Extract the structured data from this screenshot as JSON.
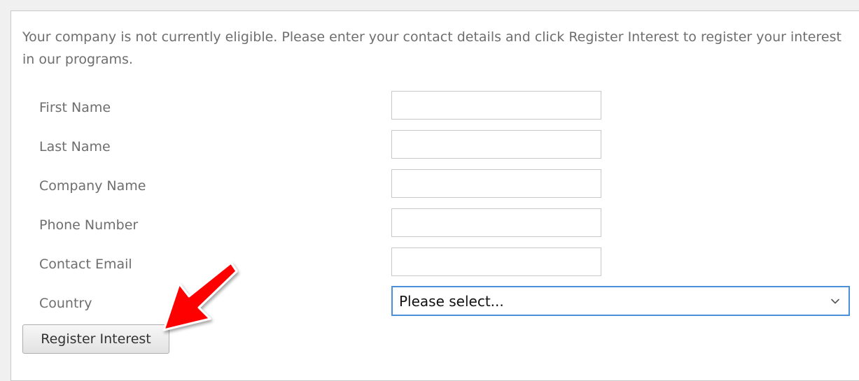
{
  "form": {
    "intro_text": "Your company is not currently eligible. Please enter your contact details and click Register Interest to register your interest in our programs.",
    "fields": {
      "first_name": {
        "label": "First Name",
        "value": ""
      },
      "last_name": {
        "label": "Last Name",
        "value": ""
      },
      "company_name": {
        "label": "Company Name",
        "value": ""
      },
      "phone_number": {
        "label": "Phone Number",
        "value": ""
      },
      "contact_email": {
        "label": "Contact Email",
        "value": ""
      },
      "country": {
        "label": "Country",
        "selected": "Please select..."
      }
    },
    "submit_label": "Register Interest"
  },
  "annotation": {
    "type": "pointer-arrow",
    "color": "#ff0000",
    "points_to": "register-interest-button"
  },
  "colors": {
    "page_background": "#f0f0f0",
    "label_text": "#6e6e6e",
    "field_border": "#c8c8c8",
    "focus_border": "#4a90d9",
    "annotation_red": "#ff0000"
  },
  "icons": {
    "select_chevron": "chevron-down-icon",
    "annotation": "arrow-icon"
  }
}
